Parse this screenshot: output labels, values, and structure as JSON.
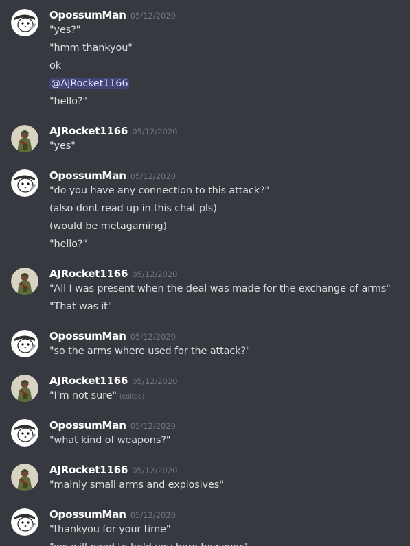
{
  "users": {
    "opossum": {
      "name": "OpossumMan"
    },
    "aj": {
      "name": "AJRocket1166"
    }
  },
  "colors": {
    "background": "#36393f",
    "username": "#ffffff",
    "text": "#dcddde",
    "timestamp": "#72767d",
    "mention_text": "#dee0fc"
  },
  "groups": [
    {
      "author": "OpossumMan",
      "timestamp": "05/12/2020",
      "avatar_icon": "opossum-avatar-icon",
      "lines": [
        "\"yes?\"",
        "\"hmm thankyou\"",
        "ok",
        "@AJRocket1166",
        "\"hello?\""
      ]
    },
    {
      "author": "AJRocket1166",
      "timestamp": "05/12/2020",
      "avatar_icon": "soldier-avatar-icon",
      "lines": [
        "\"yes\""
      ]
    },
    {
      "author": "OpossumMan",
      "timestamp": "05/12/2020",
      "avatar_icon": "opossum-avatar-icon",
      "lines": [
        "\"do you have any connection to this attack?\"",
        "(also dont read up in this chat pls)",
        "(would be metagaming)",
        "\"hello?\""
      ]
    },
    {
      "author": "AJRocket1166",
      "timestamp": "05/12/2020",
      "avatar_icon": "soldier-avatar-icon",
      "lines": [
        "\"All I was present when the deal was made for the exchange of arms\"",
        "\"That was it\""
      ]
    },
    {
      "author": "OpossumMan",
      "timestamp": "05/12/2020",
      "avatar_icon": "opossum-avatar-icon",
      "lines": [
        "\"so the arms where used for the attack?\""
      ]
    },
    {
      "author": "AJRocket1166",
      "timestamp": "05/12/2020",
      "avatar_icon": "soldier-avatar-icon",
      "lines": [
        "\"I'm not sure\""
      ],
      "edited_label": "(edited)"
    },
    {
      "author": "OpossumMan",
      "timestamp": "05/12/2020",
      "avatar_icon": "opossum-avatar-icon",
      "lines": [
        "\"what kind of weapons?\""
      ]
    },
    {
      "author": "AJRocket1166",
      "timestamp": "05/12/2020",
      "avatar_icon": "soldier-avatar-icon",
      "lines": [
        "\"mainly small arms and explosives\""
      ]
    },
    {
      "author": "OpossumMan",
      "timestamp": "05/12/2020",
      "avatar_icon": "opossum-avatar-icon",
      "lines": [
        "\"thankyou for your time\"",
        "\"we will need to hold you here however\""
      ]
    }
  ]
}
